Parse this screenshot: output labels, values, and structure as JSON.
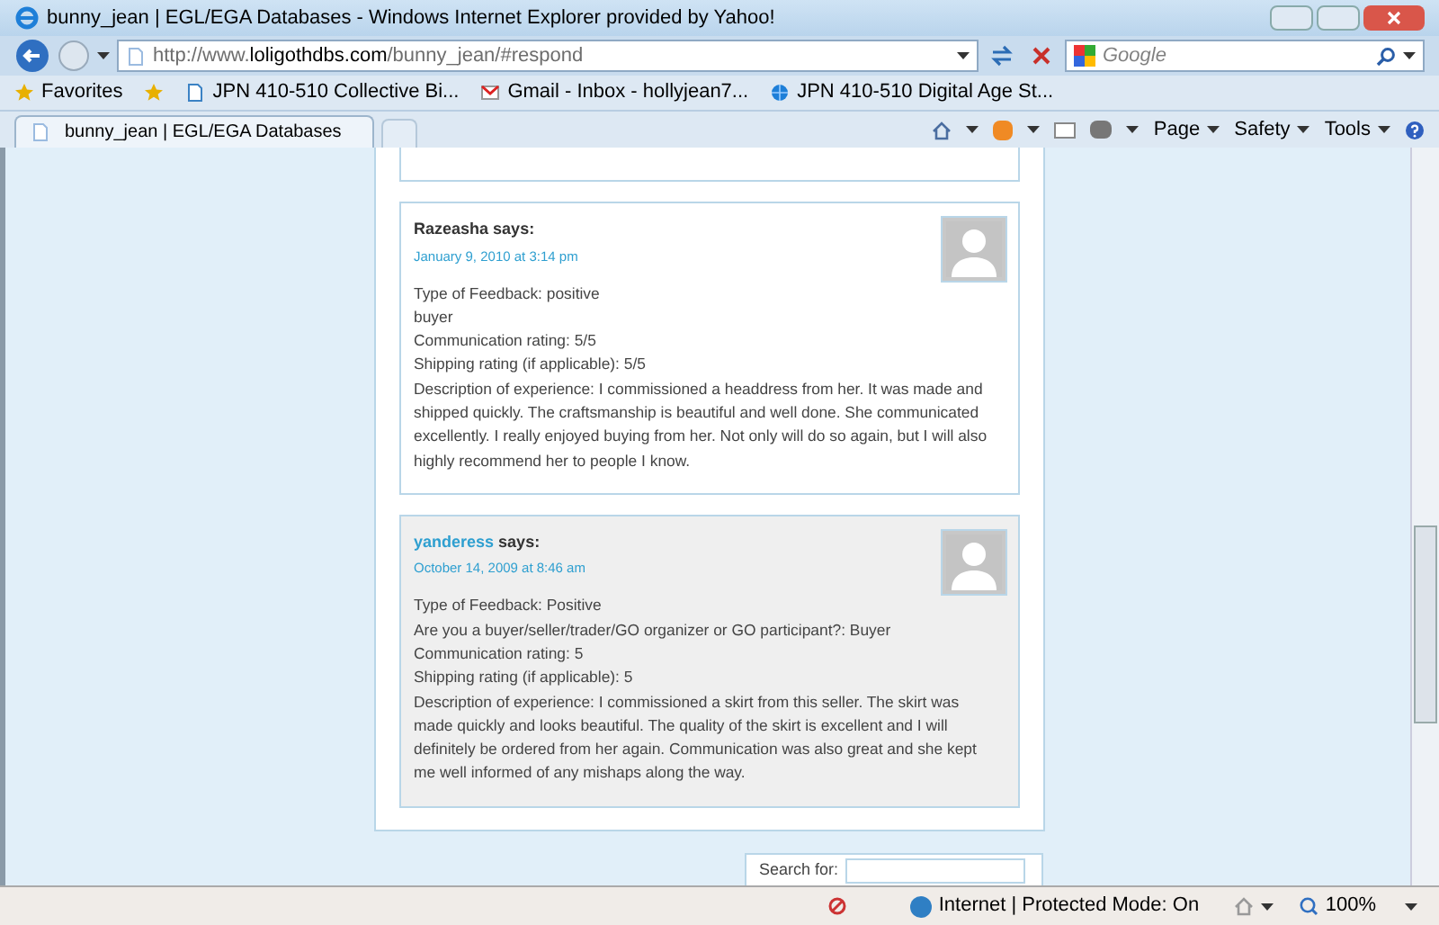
{
  "window": {
    "title": "bunny_jean | EGL/EGA Databases - Windows Internet Explorer provided by Yahoo!"
  },
  "address_bar": {
    "prefix": "http://www.",
    "domain": "loligothdbs.com",
    "path": "/bunny_jean/#respond"
  },
  "search_box": {
    "placeholder": "Google"
  },
  "favorites_bar": {
    "label": "Favorites",
    "items": [
      {
        "label": "JPN 410-510 Collective Bi..."
      },
      {
        "label": "Gmail - Inbox - hollyjean7..."
      },
      {
        "label": "JPN 410-510 Digital Age St..."
      }
    ]
  },
  "tabs": [
    {
      "label": "bunny_jean | EGL/EGA Databases",
      "selected": true
    }
  ],
  "command_bar": [
    "Page",
    "Safety",
    "Tools"
  ],
  "comments": [
    {
      "author": "Razeasha",
      "author_is_link": false,
      "says": "says:",
      "date": "January 9, 2010 at 3:14 pm",
      "shaded": false,
      "lines": [
        "Type of Feedback: positive",
        "buyer",
        "Communication rating: 5/5",
        "Shipping rating (if applicable): 5/5",
        "Description of experience: I commissioned a headdress from her. It was made and shipped quickly. The craftsmanship is beautiful and well done. She communicated excellently. I really enjoyed buying from her. Not only will do so again, but I will also highly recommend her to people I know."
      ]
    },
    {
      "author": "yanderess",
      "author_is_link": true,
      "says": "says:",
      "date": "October 14, 2009 at 8:46 am",
      "shaded": true,
      "lines": [
        "Type of Feedback: Positive",
        "Are you a buyer/seller/trader/GO organizer or GO participant?: Buyer",
        "Communication rating: 5",
        "Shipping rating (if applicable): 5",
        "Description of experience: I commissioned a skirt from this seller. The skirt was made quickly and looks beautiful. The quality of the skirt is excellent and I will definitely be ordered from her again. Communication was also great and she kept me well informed of any mishaps along the way."
      ]
    }
  ],
  "sidebar_search": {
    "label": "Search for:"
  },
  "status_bar": {
    "zone": "Internet | Protected Mode: On",
    "zoom": "100%"
  }
}
